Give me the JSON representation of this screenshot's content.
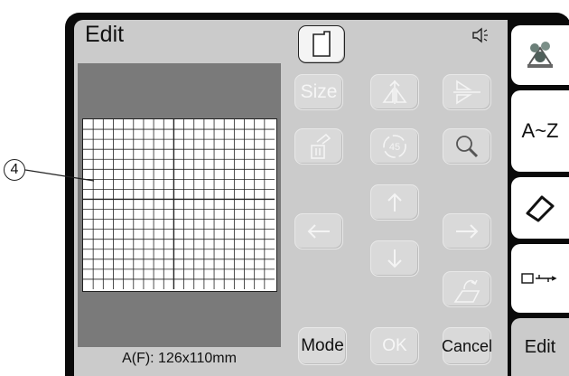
{
  "header": {
    "title": "Edit",
    "speaker_icon": "speaker-icon"
  },
  "preview": {
    "status": "A(F): 126x110mm",
    "callout": "4"
  },
  "buttons": {
    "size": "Size",
    "mode": "Mode",
    "ok": "OK",
    "cancel": "Cancel"
  },
  "tabs": {
    "az": "A~Z",
    "edit": "Edit"
  }
}
